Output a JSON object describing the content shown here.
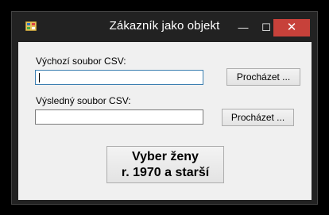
{
  "window": {
    "title": "Zákazník jako objekt",
    "minimize_glyph": "—",
    "maximize_glyph": "☐",
    "close_glyph": "✕",
    "close_color": "#c7413a",
    "app_icon": "windows-form-icon"
  },
  "form": {
    "source_label": "Výchozí soubor CSV:",
    "source_value": "",
    "source_browse": "Procházet ...",
    "result_label": "Výsledný soubor CSV:",
    "result_value": "",
    "result_browse": "Procházet ...",
    "action_line1": "Vyber ženy",
    "action_line2": "r. 1970 a starší"
  }
}
